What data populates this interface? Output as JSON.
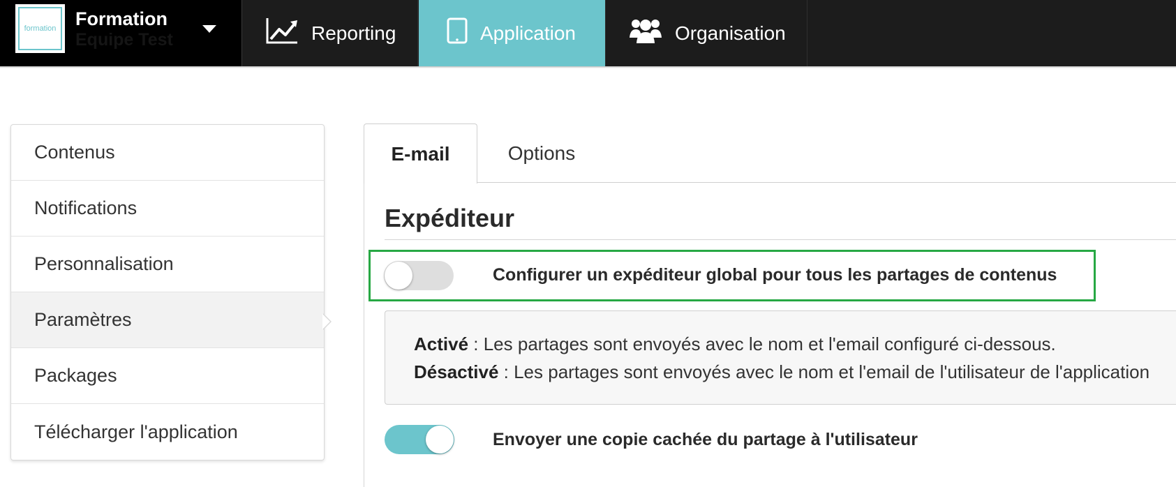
{
  "colors": {
    "topbar": "#1c1c1c",
    "accent": "#6cc5cc",
    "highlight": "#27a844",
    "toggle_off": "#dedede"
  },
  "brand": {
    "logo_text": "formation",
    "title": "Formation",
    "subtitle": "Equipe Test",
    "icon": "chevron-down-icon"
  },
  "nav": {
    "reporting": {
      "label": "Reporting",
      "icon": "chart-line-icon"
    },
    "application": {
      "label": "Application",
      "icon": "tablet-icon",
      "active": true
    },
    "organisation": {
      "label": "Organisation",
      "icon": "users-icon"
    }
  },
  "sidebar": {
    "items": [
      {
        "label": "Contenus"
      },
      {
        "label": "Notifications"
      },
      {
        "label": "Personnalisation"
      },
      {
        "label": "Paramètres",
        "active": true
      },
      {
        "label": "Packages"
      },
      {
        "label": "Télécharger l'application"
      }
    ]
  },
  "tabs": {
    "email": "E-mail",
    "options": "Options",
    "active": "E-mail"
  },
  "section": {
    "title": "Expéditeur"
  },
  "settings": {
    "global_sender": {
      "label": "Configurer un expéditeur global pour tous les partages de contenus",
      "enabled": false
    },
    "info": {
      "active_label": "Activé",
      "active_text": " : Les partages sont envoyés avec le nom et l'email configuré ci-dessous.",
      "inactive_label": "Désactivé",
      "inactive_text": " : Les partages sont envoyés avec le nom et l'email de l'utilisateur de l'application"
    },
    "bcc_copy": {
      "label": "Envoyer une copie cachée du partage à l'utilisateur",
      "enabled": true
    }
  }
}
